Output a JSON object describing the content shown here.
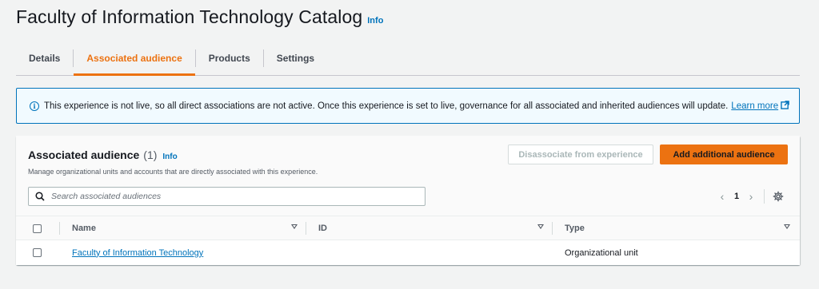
{
  "header": {
    "title": "Faculty of Information Technology Catalog",
    "info_label": "Info"
  },
  "tabs": [
    {
      "label": "Details",
      "active": false
    },
    {
      "label": "Associated audience",
      "active": true
    },
    {
      "label": "Products",
      "active": false
    },
    {
      "label": "Settings",
      "active": false
    }
  ],
  "alert": {
    "text": "This experience is not live, so all direct associations are not active. Once this experience is set to live, governance for all associated and inherited audiences will update.",
    "link_label": "Learn more"
  },
  "audience": {
    "title": "Associated audience",
    "count": "(1)",
    "info_label": "Info",
    "description": "Manage organizational units and accounts that are directly associated with this experience.",
    "disassociate_label": "Disassociate from experience",
    "add_label": "Add additional audience",
    "search_placeholder": "Search associated audiences",
    "page": "1",
    "columns": [
      "Name",
      "ID",
      "Type"
    ],
    "rows": [
      {
        "name": "Faculty of Information Technology",
        "id": "",
        "type": "Organizational unit"
      }
    ]
  },
  "colors": {
    "accent": "#ec7211",
    "link": "#0073bb",
    "alert_bg": "#f1faff",
    "page_bg": "#f2f3f3"
  },
  "icons": [
    "info-circle-icon",
    "external-link-icon",
    "search-icon",
    "chevron-left-icon",
    "chevron-right-icon",
    "gear-icon",
    "sort-caret-icon"
  ]
}
